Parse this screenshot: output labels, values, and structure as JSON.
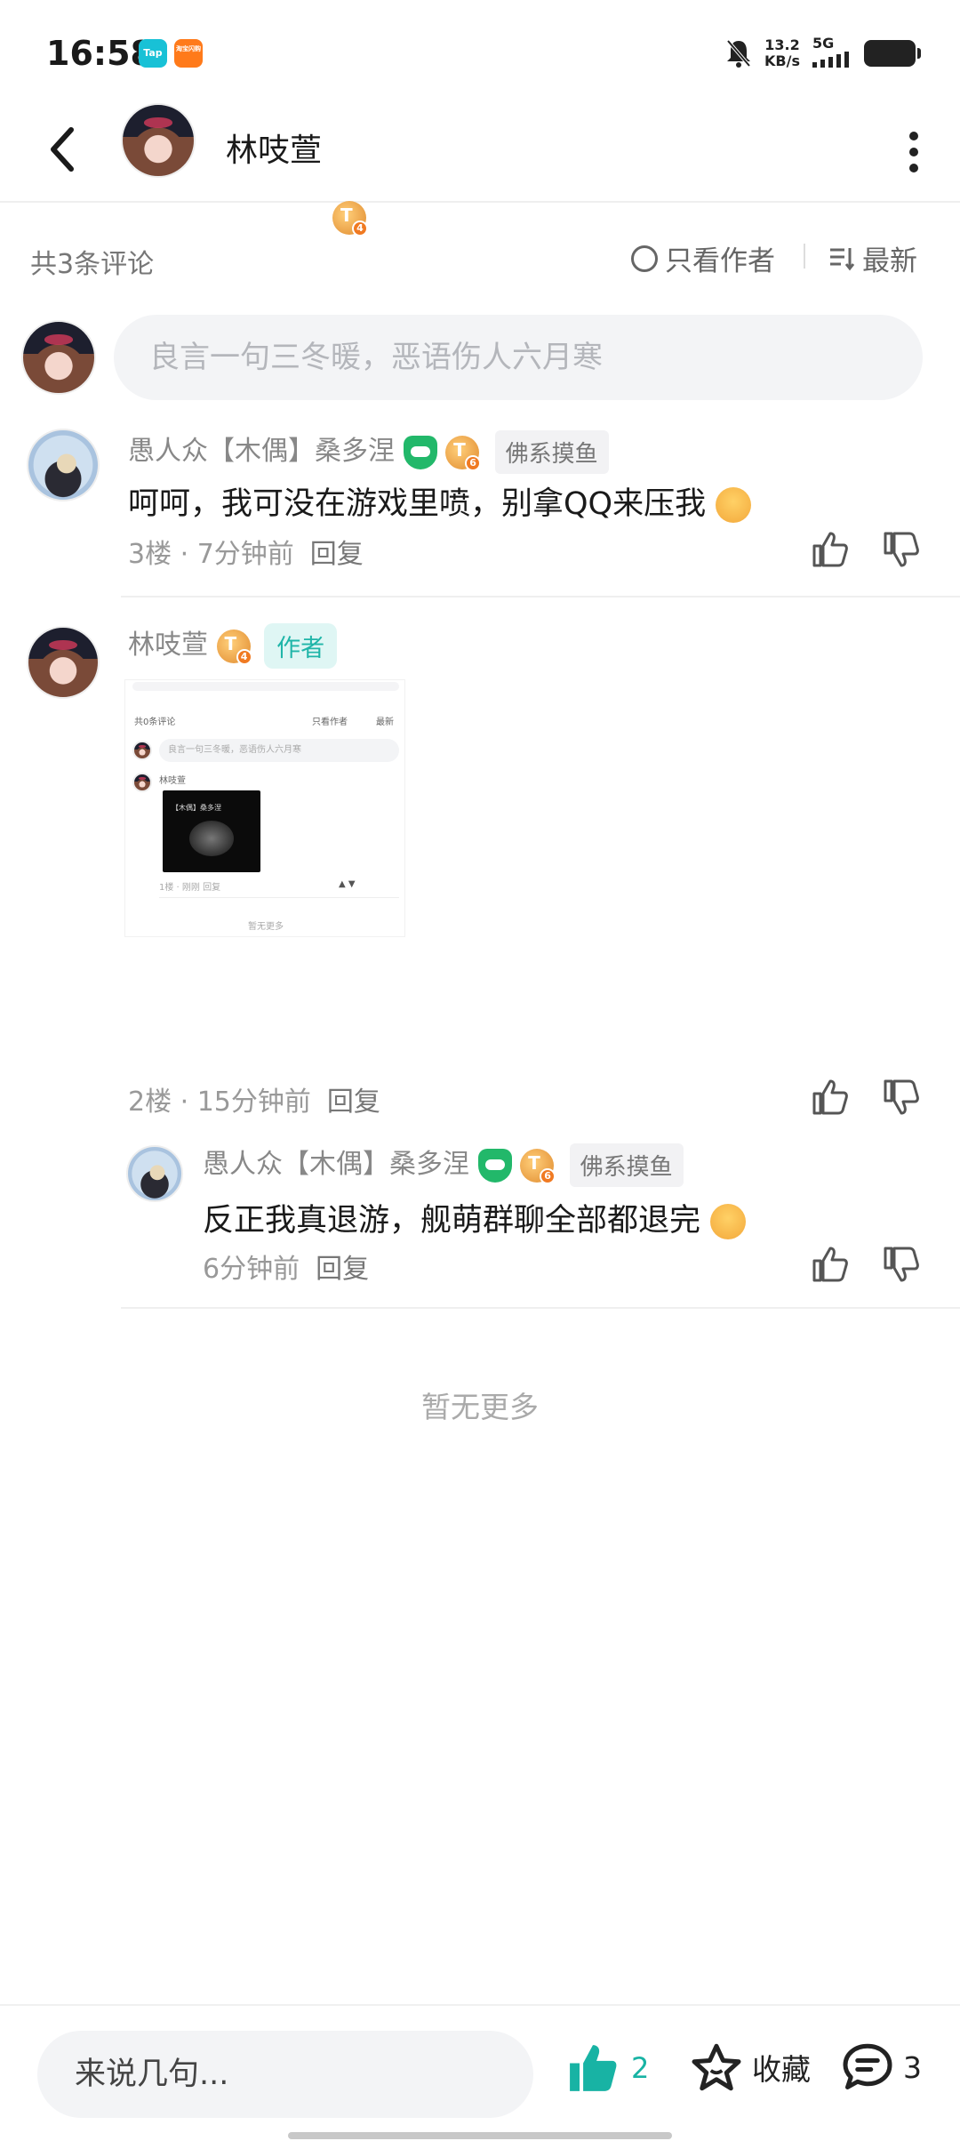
{
  "status_bar": {
    "time": "16:58",
    "app_icon_1": "Tap",
    "app_icon_2": "淘宝闪购",
    "net_speed": "13.2",
    "net_unit": "KB/s",
    "signal": "5G",
    "icons": [
      "silent-bell-icon",
      "signal-icon",
      "battery-icon"
    ]
  },
  "header": {
    "username": "林吱萱",
    "level": "4"
  },
  "filter": {
    "count_label": "共3条评论",
    "only_author": "只看作者",
    "sort": "最新"
  },
  "comment_input": {
    "placeholder": "良言一句三冬暖，恶语伤人六月寒"
  },
  "comments": [
    {
      "user": "愚人众【木偶】桑多涅",
      "level": "6",
      "tag": "佛系摸鱼",
      "text": "呵呵，我可没在游戏里喷，别拿QQ来压我",
      "floor": "3楼 · 7分钟前",
      "reply": "回复"
    },
    {
      "user": "林吱萱",
      "level": "4",
      "author_tag": "作者",
      "image_texts": {
        "count": "共0条评论",
        "only_author": "只看作者",
        "sort": "最新",
        "input": "良言一句三冬暖，恶语伤人六月寒",
        "user": "林吱萱",
        "caption": "【木偶】桑多涅",
        "meta": "1楼 · 刚刚",
        "reply": "回复",
        "nomore": "暂无更多"
      },
      "floor": "2楼 · 15分钟前",
      "reply": "回复",
      "sub_reply": {
        "user": "愚人众【木偶】桑多涅",
        "level": "6",
        "tag": "佛系摸鱼",
        "text": "反正我真退游，舰萌群聊全部都退完",
        "time": "6分钟前",
        "reply": "回复"
      }
    }
  ],
  "end_text": "暂无更多",
  "bottom_bar": {
    "input_placeholder": "来说几句...",
    "like_count": "2",
    "favorite_label": "收藏",
    "comment_count": "3"
  },
  "colors": {
    "accent": "#18b3a4",
    "level_badge": "#e08a2e",
    "game_badge": "#22b86a"
  }
}
